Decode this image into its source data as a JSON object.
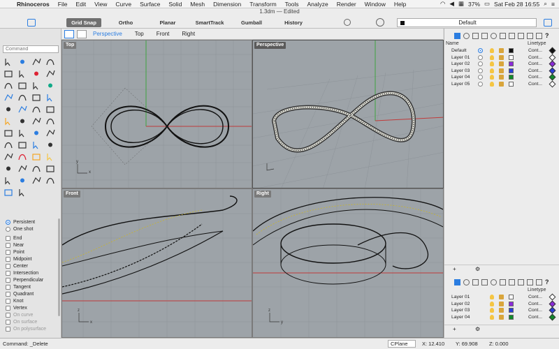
{
  "menubar": {
    "app": "Rhinoceros",
    "items": [
      "File",
      "Edit",
      "View",
      "Curve",
      "Surface",
      "Solid",
      "Mesh",
      "Dimension",
      "Transform",
      "Tools",
      "Analyze",
      "Render",
      "Window",
      "Help"
    ],
    "battery": "37%",
    "clock": "Sat Feb 28  16:55"
  },
  "window": {
    "title": "1.3dm — Edited"
  },
  "toolbar": {
    "buttons": [
      "Grid Snap",
      "Ortho",
      "Planar",
      "SmartTrack",
      "Gumball",
      "History"
    ],
    "layer_current": "Default"
  },
  "command": {
    "placeholder": "Command"
  },
  "viewport_tabs": [
    "Perspective",
    "Top",
    "Front",
    "Right"
  ],
  "viewports": {
    "top": "Top",
    "perspective": "Perspective",
    "front": "Front",
    "right": "Right",
    "axis_x": "x",
    "axis_y": "y",
    "axis_z": "z"
  },
  "osnap": {
    "modes": [
      "Persistent",
      "One shot"
    ],
    "items": [
      "End",
      "Near",
      "Point",
      "Midpoint",
      "Center",
      "Intersection",
      "Perpendicular",
      "Tangent",
      "Quadrant",
      "Knot",
      "Vertex"
    ],
    "dim_items": [
      "On curve",
      "On surface",
      "On polysurface"
    ]
  },
  "layers": {
    "header_name": "Name",
    "header_linetype": "Linetype",
    "linetype_value": "Cont...",
    "rows": [
      {
        "name": "Default",
        "color": "#111111",
        "current": true
      },
      {
        "name": "Layer 01",
        "color": "#ffffff",
        "current": false
      },
      {
        "name": "Layer 02",
        "color": "#8b2bd9",
        "current": false
      },
      {
        "name": "Layer 03",
        "color": "#2a3fd6",
        "current": false
      },
      {
        "name": "Layer 04",
        "color": "#138a2b",
        "current": false
      },
      {
        "name": "Layer 05",
        "color": "#ffffff",
        "current": false
      }
    ],
    "rows2": [
      {
        "name": "Layer 01",
        "color": "#ffffff"
      },
      {
        "name": "Layer 02",
        "color": "#8b2bd9"
      },
      {
        "name": "Layer 03",
        "color": "#2a3fd6"
      },
      {
        "name": "Layer 04",
        "color": "#138a2b"
      }
    ],
    "footer_add": "+",
    "footer_gear": "⚙"
  },
  "status": {
    "command_line": "Command: _Delete",
    "cplane": "CPlane",
    "x": "X: 12.410",
    "y": "Y: 69.908",
    "z": "Z: 0.000"
  },
  "icons": [
    "apple-icon",
    "sidebar-toggle-icon",
    "history-icon",
    "record-icon",
    "panel-toggle-icon",
    "layers-icon",
    "help-icon"
  ]
}
